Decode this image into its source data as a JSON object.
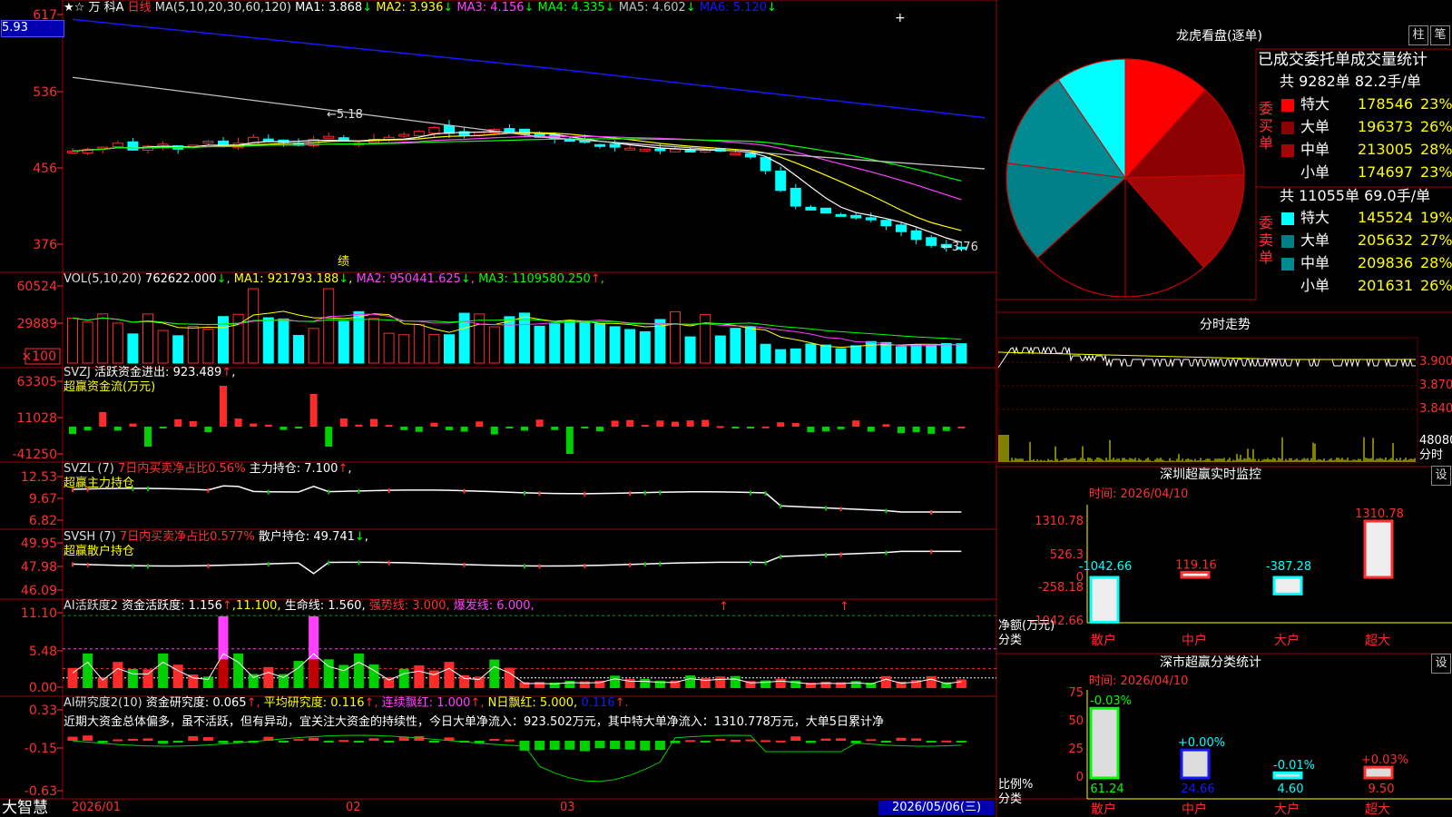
{
  "colors": {
    "up": "#ff2a2a",
    "down": "#00ffff",
    "ma1": "#ffffff",
    "ma2": "#ffff00",
    "ma3": "#ff40ff",
    "ma4": "#00ff00",
    "ma5": "#c0c0c0",
    "ma6": "#1818ff",
    "grid": "#a00000",
    "axis": "#ff3030"
  },
  "header": {
    "name": "万 科A",
    "period": "日线",
    "ma_title": "MA(5,10,20,30,60,120)",
    "ma": [
      {
        "label": "MA1:",
        "value": "3.868",
        "arrow": "↓"
      },
      {
        "label": "MA2:",
        "value": "3.936",
        "arrow": "↓"
      },
      {
        "label": "MA3:",
        "value": "4.156",
        "arrow": "↓"
      },
      {
        "label": "MA4:",
        "value": "4.335",
        "arrow": "↓"
      },
      {
        "label": "MA5:",
        "value": "4.602",
        "arrow": "↓"
      },
      {
        "label": "MA6:",
        "value": "5.120",
        "arrow": "↓"
      }
    ],
    "cursor_price": "5.93",
    "price_ticks": [
      "617",
      "536",
      "456",
      "376"
    ],
    "hi_label": "5.18",
    "lo_label": "←3.76",
    "marker": "绩"
  },
  "vol": {
    "title": "VOL(5,10,20)",
    "value": "762622.000",
    "arrow": "↓",
    "ma": [
      {
        "label": "MA1:",
        "value": "921793.188",
        "arrow": "↓"
      },
      {
        "label": "MA2:",
        "value": "950441.625",
        "arrow": "↓"
      },
      {
        "label": "MA3:",
        "value": "1109580.250",
        "arrow": "↑"
      }
    ],
    "ticks": [
      "60524",
      "29889"
    ],
    "unit": "×100"
  },
  "svzj": {
    "title": "SVZJ",
    "label": "活跃资金进出:",
    "value": "923.489",
    "arrow": "↑",
    "suffix": ",",
    "sub": "超赢资金流(万元)",
    "ticks": [
      "63305",
      "11028",
      "-41250"
    ]
  },
  "svzl": {
    "title": "SVZL (7)",
    "p1": "7日内买卖净占比0.56%",
    "p2": "主力持仓:",
    "value": "7.100",
    "arrow": "↑",
    "suffix": ",",
    "sub": "超赢主力持仓",
    "ticks": [
      "12.53",
      "9.67",
      "6.82"
    ]
  },
  "svsh": {
    "title": "SVSH (7)",
    "p1": "7日内买卖净占比0.577%",
    "p2": "散户持仓:",
    "value": "49.741",
    "arrow": "↓",
    "suffix": ",",
    "sub": "超赢散户持仓",
    "ticks": [
      "49.95",
      "47.98",
      "46.09"
    ]
  },
  "ai1": {
    "title": "AI活跃度2",
    "p1": "资金活跃度:",
    "v1": "1.156",
    "a1": "↑",
    "v2": ",11.100,",
    "p3": "生命线:",
    "v3": "1.560,",
    "p4": "强势线:",
    "v4": "3.000,",
    "p5": "爆发线:",
    "v5": "6.000,",
    "ticks": [
      "11.10",
      "5.48",
      "0.00"
    ]
  },
  "ai2": {
    "title": "AI研究度2(10)",
    "p1": "资金研究度:",
    "v1": "0.065",
    "a1": "↑,",
    "p2": "平均研究度:",
    "v2": "0.116",
    "a2": "↑,",
    "p3": "连续飘红:",
    "v3": "1.000",
    "a3": "↑,",
    "p4": "N日飘红:",
    "v4": "5.000,",
    "v5": "0.116",
    "a5": "↑.",
    "text": "近期大资金总体偏多，虽不活跃，但有异动，宜关注大资金的持续性，今日大单净流入：923.502万元，其中特大单净流入：1310.778万元，大单5日累计净",
    "ticks": [
      "0.33",
      "-0.15",
      "-0.63"
    ]
  },
  "dates": {
    "brand": "大智慧",
    "d1": "2026/01",
    "d2": "02",
    "d3": "03",
    "current": "2026/05/06(三)"
  },
  "lhb": {
    "title": "龙虎看盘(逐单)",
    "btn1": "柱",
    "btn2": "笔",
    "header": "已成交委托单成交量统计",
    "buy": {
      "side": "委买单",
      "summary": "共 9282单 82.2手/单",
      "rows": [
        {
          "name": "特大",
          "value": "178546",
          "pct": "23%",
          "color": "#ff0000"
        },
        {
          "name": "大单",
          "value": "196373",
          "pct": "26%",
          "color": "#8b0000"
        },
        {
          "name": "中单",
          "value": "213005",
          "pct": "28%",
          "color": "#a00808"
        },
        {
          "name": "小单",
          "value": "174697",
          "pct": "23%",
          "color": "#000000"
        }
      ]
    },
    "sell": {
      "side": "委卖单",
      "summary": "共 11055单 69.0手/单",
      "rows": [
        {
          "name": "特大",
          "value": "145524",
          "pct": "19%",
          "color": "#00ffff"
        },
        {
          "name": "大单",
          "value": "205632",
          "pct": "27%",
          "color": "#007f86"
        },
        {
          "name": "中单",
          "value": "209836",
          "pct": "28%",
          "color": "#008a92"
        },
        {
          "name": "小单",
          "value": "201631",
          "pct": "26%",
          "color": "#000000"
        }
      ]
    }
  },
  "fenshi": {
    "title": "分时走势",
    "ticks": [
      "3.900",
      "3.870",
      "3.840"
    ],
    "vol_tick": "48080",
    "unit": "分时"
  },
  "monitor": {
    "title": "深圳超赢实时监控",
    "btn": "设",
    "time": "时间: 2026/04/10",
    "ylabel": "净额(万元)",
    "xlabel": "分类",
    "ticks": [
      "1310.78",
      "526.3",
      "0",
      "-258.18",
      "-1042.66"
    ],
    "cats": [
      "散户",
      "中户",
      "大户",
      "超大"
    ],
    "values": [
      -1042.66,
      119.16,
      -387.28,
      1310.78
    ],
    "labels": [
      "-1042.66",
      "119.16",
      "-387.28",
      "1310.78"
    ]
  },
  "classify": {
    "title": "深市超赢分类统计",
    "btn": "设",
    "time": "时间: 2026/04/10",
    "ylabel": "比例%",
    "xlabel": "分类",
    "ticks": [
      "75",
      "50",
      "25",
      "0"
    ],
    "cats": [
      "散户",
      "中户",
      "大户",
      "超大"
    ],
    "values": [
      61.24,
      24.66,
      4.6,
      9.5
    ],
    "values_label": [
      "61.24",
      "24.66",
      "4.60",
      "9.50"
    ],
    "changes": [
      "-0.03%",
      "+0.00%",
      "-0.01%",
      "+0.03%"
    ]
  }
}
